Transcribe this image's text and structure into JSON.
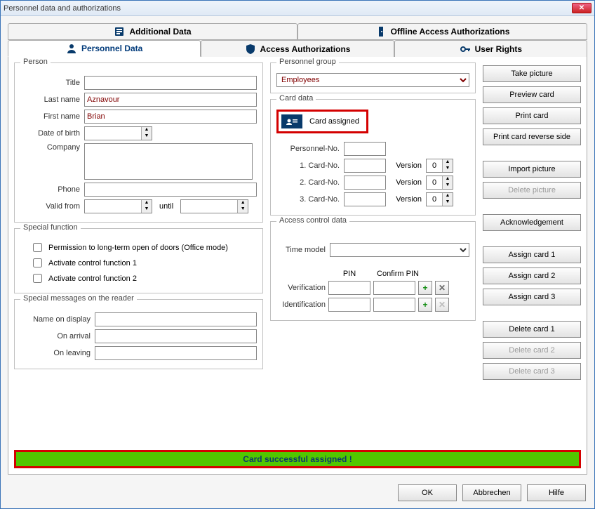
{
  "window": {
    "title": "Personnel data and authorizations"
  },
  "tabs": {
    "upper": [
      {
        "label": "Additional Data"
      },
      {
        "label": "Offline Access Authorizations"
      }
    ],
    "lower": [
      {
        "label": "Personnel Data"
      },
      {
        "label": "Access Authorizations"
      },
      {
        "label": "User Rights"
      }
    ]
  },
  "person": {
    "legend": "Person",
    "title_label": "Title",
    "title": "",
    "lastname_label": "Last name",
    "lastname": "Aznavour",
    "firstname_label": "First name",
    "firstname": "Brian",
    "dob_label": "Date of birth",
    "dob": "",
    "company_label": "Company",
    "company": "",
    "phone_label": "Phone",
    "phone": "",
    "validfrom_label": "Valid from",
    "validfrom": "",
    "until_label": "until",
    "validuntil": ""
  },
  "special": {
    "legend": "Special function",
    "perm_label": "Permission to long-term open of doors (Office mode)",
    "cf1_label": "Activate control function 1",
    "cf2_label": "Activate control function 2"
  },
  "reader": {
    "legend": "Special messages on the reader",
    "name_label": "Name on display",
    "name": "",
    "arrival_label": "On arrival",
    "arrival": "",
    "leaving_label": "On leaving",
    "leaving": ""
  },
  "pgroup": {
    "legend": "Personnel group",
    "selected": "Employees"
  },
  "card": {
    "legend": "Card data",
    "status": "Card assigned",
    "pno_label": "Personnel-No.",
    "pno": "",
    "c1_label": "1. Card-No.",
    "c1": "",
    "v_label": "Version",
    "v1": "0",
    "c2_label": "2. Card-No.",
    "c2": "",
    "v2": "0",
    "c3_label": "3. Card-No.",
    "c3": "",
    "v3": "0"
  },
  "acd": {
    "legend": "Access control data",
    "timemodel_label": "Time model",
    "timemodel": "",
    "pin_label": "PIN",
    "cpin_label": "Confirm PIN",
    "verif_label": "Verification",
    "verif": "",
    "cverif": "",
    "ident_label": "Identification",
    "ident": "",
    "cident": ""
  },
  "rbtn": {
    "take_picture": "Take picture",
    "preview_card": "Preview card",
    "print_card": "Print card",
    "print_reverse": "Print card reverse side",
    "import_picture": "Import picture",
    "delete_picture": "Delete picture",
    "ack": "Acknowledgement",
    "assign1": "Assign card 1",
    "assign2": "Assign card 2",
    "assign3": "Assign card 3",
    "delete1": "Delete card 1",
    "delete2": "Delete card 2",
    "delete3": "Delete card 3"
  },
  "status": "Card successful assigned !",
  "dialog": {
    "ok": "OK",
    "cancel": "Abbrechen",
    "help": "Hilfe"
  }
}
